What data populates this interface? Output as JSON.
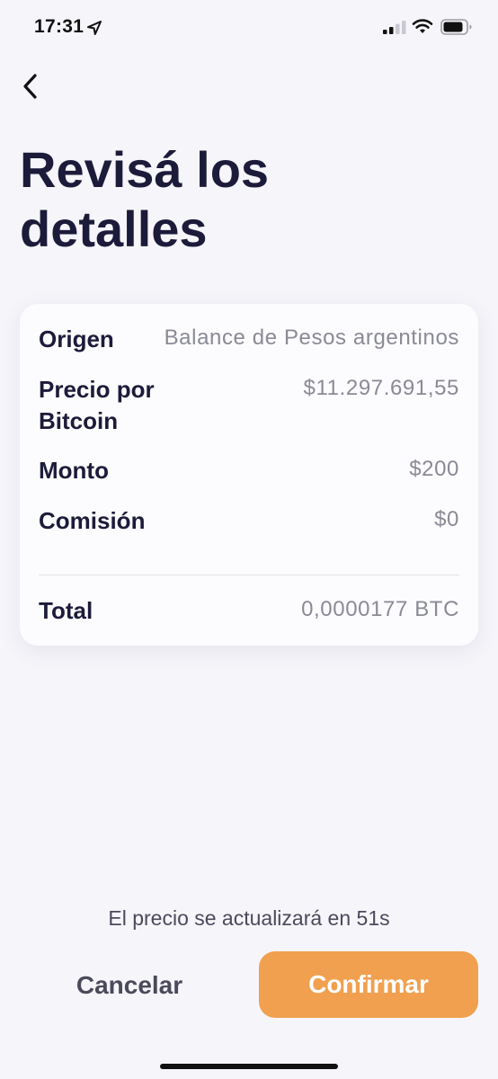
{
  "status_bar": {
    "time": "17:31",
    "icons": [
      "location-arrow-icon",
      "signal-icon",
      "wifi-icon",
      "battery-icon"
    ]
  },
  "header": {
    "back_icon": "chevron-left-icon",
    "title": "Revisá los detalles"
  },
  "details": {
    "origen": {
      "label": "Origen",
      "value": "Balance de Pesos argentinos"
    },
    "precio": {
      "label": "Precio por Bitcoin",
      "value": "$11.297.691,55"
    },
    "monto": {
      "label": "Monto",
      "value": "$200"
    },
    "comision": {
      "label": "Comisión",
      "value": "$0"
    },
    "total": {
      "label": "Total",
      "value": "0,0000177 BTC"
    }
  },
  "footer": {
    "price_update_text": "El precio se actualizará en 51s",
    "cancel_label": "Cancelar",
    "confirm_label": "Confirmar"
  },
  "colors": {
    "background": "#f6f5fa",
    "card": "#fcfcfe",
    "title_text": "#1c1b3a",
    "value_text": "#8a8a96",
    "confirm_button": "#f0a04f"
  }
}
